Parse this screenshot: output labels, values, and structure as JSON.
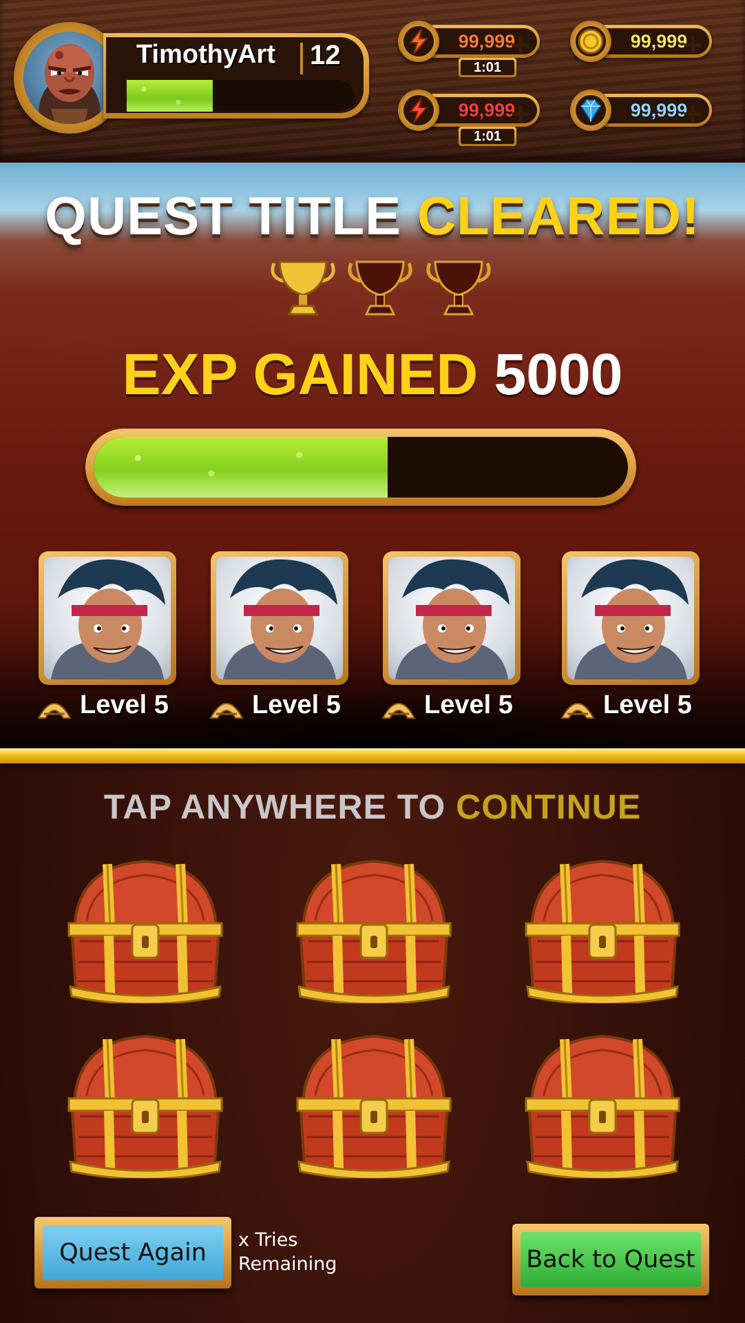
{
  "player": {
    "name": "TimothyArt",
    "level": "12",
    "xp_fraction": 0.38
  },
  "resources": [
    {
      "id": "energy-1",
      "icon": "lightning-icon",
      "value": "99,999",
      "color": "#ff7a2a",
      "timer": "1:01"
    },
    {
      "id": "gold",
      "icon": "gold-coin-icon",
      "value": "99,999",
      "color": "#ffe45a"
    },
    {
      "id": "energy-2",
      "icon": "lightning-icon",
      "value": "99,999",
      "color": "#ff3b3b",
      "timer": "1:01"
    },
    {
      "id": "gems",
      "icon": "diamond-icon",
      "value": "99,999",
      "color": "#8fd4ff"
    }
  ],
  "result": {
    "title_white": "QUEST TITLE",
    "title_yellow": "CLEARED!",
    "trophies_earned": 1,
    "trophies_total": 3,
    "exp_label": "EXP GAINED",
    "exp_value": "5000",
    "exp_fraction": 0.55
  },
  "heroes": [
    {
      "level_label": "Level 5"
    },
    {
      "level_label": "Level 5"
    },
    {
      "level_label": "Level 5"
    },
    {
      "level_label": "Level 5"
    }
  ],
  "prompt": {
    "part1": "TAP ANYWHERE TO",
    "part2": "CONTINUE"
  },
  "buttons": {
    "quest_again": "Quest Again",
    "tries_line1": "x Tries",
    "tries_line2": "Remaining",
    "back_to_quest": "Back to Quest"
  },
  "colors": {
    "gold_accent": "#ffd21a",
    "button_blue": "#3ea6d8",
    "button_green": "#2fae35"
  }
}
